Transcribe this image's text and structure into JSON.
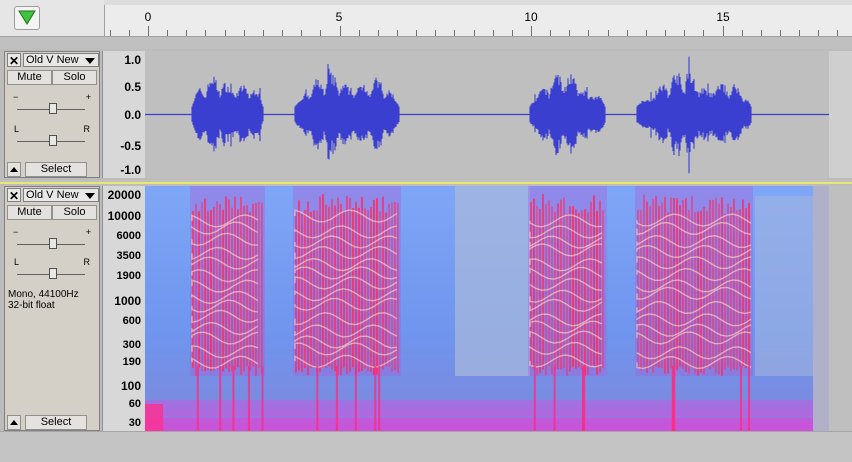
{
  "timeline": {
    "ticks": [
      "0",
      "5",
      "10",
      "15"
    ],
    "play_indicator_icon": "play-head-triangle-icon"
  },
  "tracks": [
    {
      "close_label": "✕",
      "name": "Old V New",
      "mute_label": "Mute",
      "solo_label": "Solo",
      "gain_minus": "−",
      "gain_plus": "+",
      "pan_left": "L",
      "pan_right": "R",
      "select_label": "Select",
      "view": "waveform",
      "ruler_labels": [
        "1.0",
        "0.5",
        "0.0",
        "-0.5",
        "-1.0"
      ]
    },
    {
      "close_label": "✕",
      "name": "Old V New",
      "mute_label": "Mute",
      "solo_label": "Solo",
      "gain_minus": "−",
      "gain_plus": "+",
      "pan_left": "L",
      "pan_right": "R",
      "info_line1": "Mono, 44100Hz",
      "info_line2": "32-bit float",
      "select_label": "Select",
      "view": "spectrogram",
      "ruler_labels": [
        "20000",
        "10000",
        "6000",
        "3500",
        "1900",
        "1000",
        "600",
        "300",
        "190",
        "100",
        "60",
        "30"
      ]
    }
  ],
  "colors": {
    "waveform": "#3b3fd0",
    "spectrogram_bg": "#6f95ee",
    "spectrogram_hot": "#ff2a60",
    "spectrogram_peak": "#fff0d0"
  }
}
